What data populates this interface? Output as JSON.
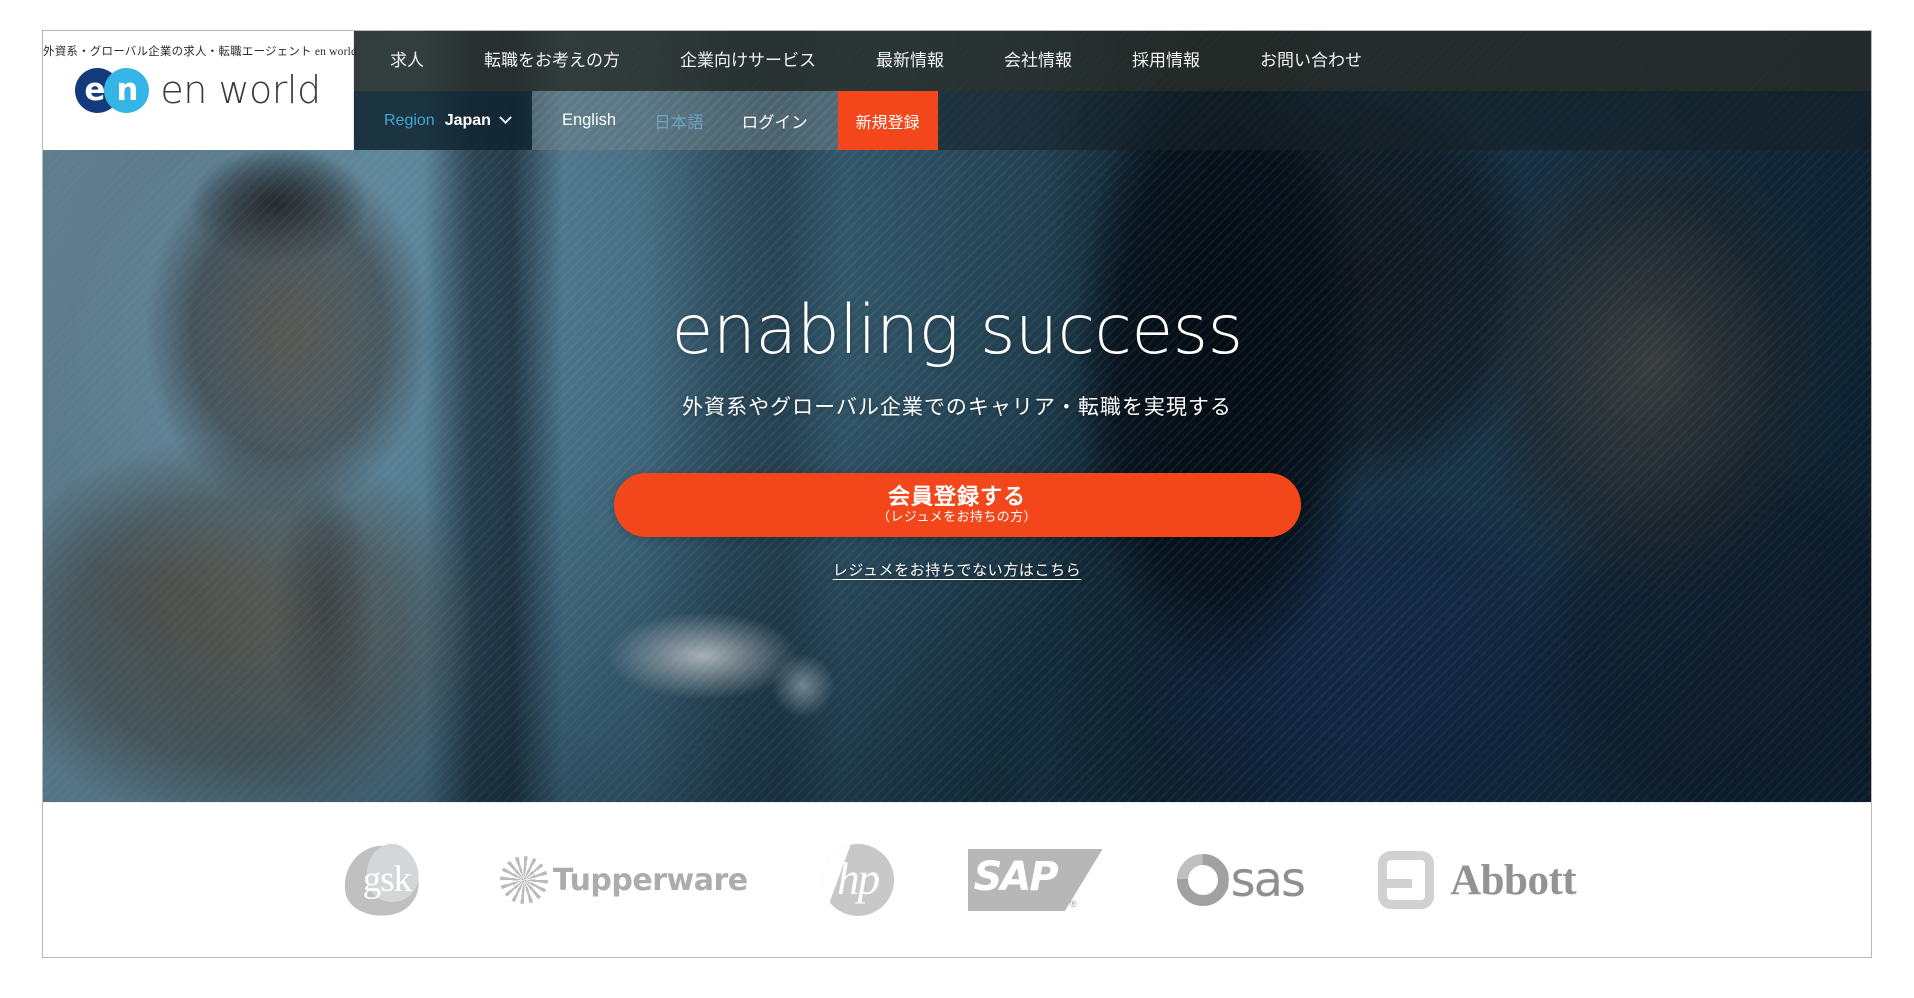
{
  "brand": {
    "tagline": "外資系・グローバル企業の求人・転職エージェント en world",
    "logo_glyph_e": "e",
    "logo_glyph_n": "n",
    "wordmark": "en world",
    "colors": {
      "logo_dark_blue": "#133a7c",
      "logo_light_blue": "#35b5e5",
      "accent_orange": "#f4461b",
      "link_blue": "#3fa8d8"
    }
  },
  "nav": {
    "items": [
      {
        "label": "求人",
        "name": "nav-item-jobs"
      },
      {
        "label": "転職をお考えの方",
        "name": "nav-item-career-changers"
      },
      {
        "label": "企業向けサービス",
        "name": "nav-item-corporate-services"
      },
      {
        "label": "最新情報",
        "name": "nav-item-latest-news"
      },
      {
        "label": "会社情報",
        "name": "nav-item-company-info"
      },
      {
        "label": "採用情報",
        "name": "nav-item-recruit"
      },
      {
        "label": "お問い合わせ",
        "name": "nav-item-contact"
      }
    ]
  },
  "utility": {
    "region_label": "Region",
    "region_value": "Japan",
    "region_chevron_icon": "chevron-down-icon",
    "lang_english": "English",
    "lang_japanese": "日本語",
    "login": "ログイン",
    "signup": "新規登録"
  },
  "hero": {
    "title": "enabling success",
    "subtitle": "外資系やグローバル企業でのキャリア・転職を実現する",
    "cta_main": "会員登録する",
    "cta_sub": "（レジュメをお持ちの方）",
    "secondary_link": "レジュメをお持ちでない方はこちら"
  },
  "clients": [
    {
      "name": "gsk",
      "label": "gsk"
    },
    {
      "name": "tupperware",
      "label": "Tupperware"
    },
    {
      "name": "hp",
      "label": "hp"
    },
    {
      "name": "sap",
      "label": "SAP",
      "registered": "®"
    },
    {
      "name": "sas",
      "label": "sas"
    },
    {
      "name": "abbott",
      "label": "Abbott"
    }
  ]
}
